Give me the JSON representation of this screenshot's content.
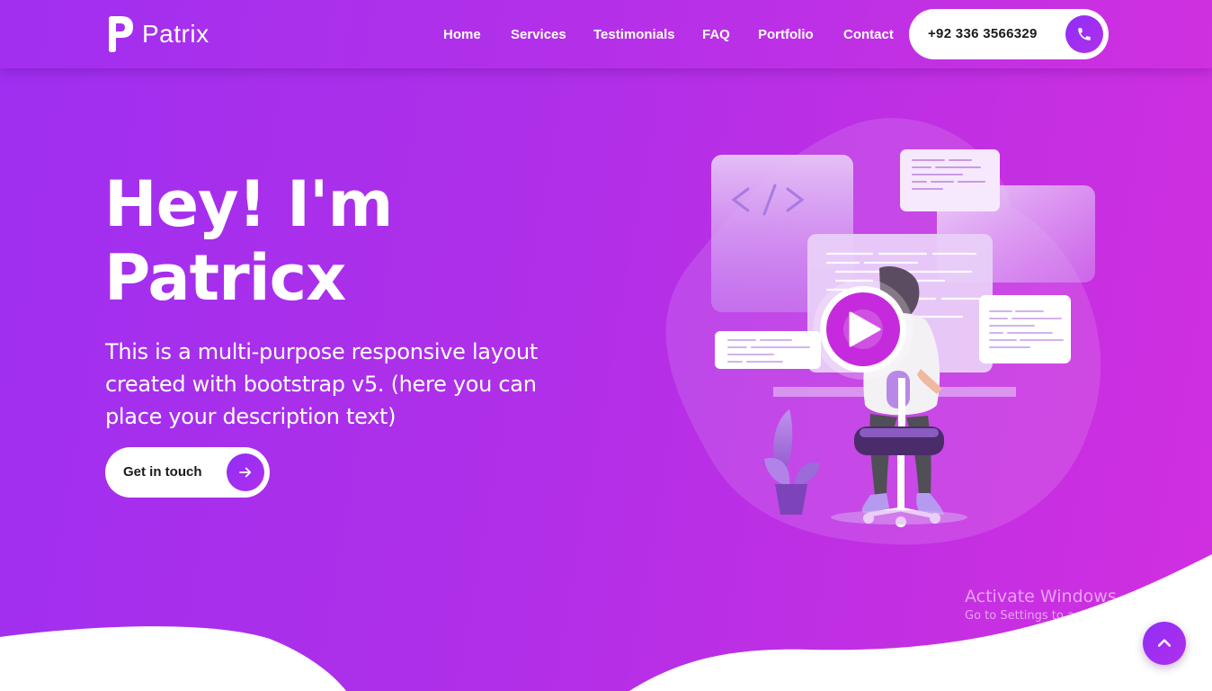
{
  "brand": {
    "name": "Patrix"
  },
  "nav": {
    "items": [
      {
        "label": "Home"
      },
      {
        "label": "Services"
      },
      {
        "label": "Testimonials"
      },
      {
        "label": "FAQ"
      },
      {
        "label": "Portfolio"
      },
      {
        "label": "Contact"
      }
    ],
    "phone": "+92 336 3566329"
  },
  "hero": {
    "title_line1": "Hey! I'm",
    "title_line2": "Patricx",
    "description": "This is a multi-purpose responsive layout created with bootstrap v5. (here you can place your description text)",
    "cta_label": "Get in touch"
  },
  "watermark": {
    "title": "Activate Windows",
    "subtitle": "Go to Settings to activate Windows."
  },
  "icons": {
    "phone": "phone-icon",
    "arrow": "arrow-right-icon",
    "play": "play-icon",
    "code": "code-icon",
    "scroll_top": "chevron-up-icon"
  },
  "colors": {
    "gradient_start": "#9f2ff0",
    "gradient_end": "#d12fdf",
    "accent": "#a02ff0",
    "button_bg": "#ffffff",
    "button_text": "#1a1a1a"
  }
}
